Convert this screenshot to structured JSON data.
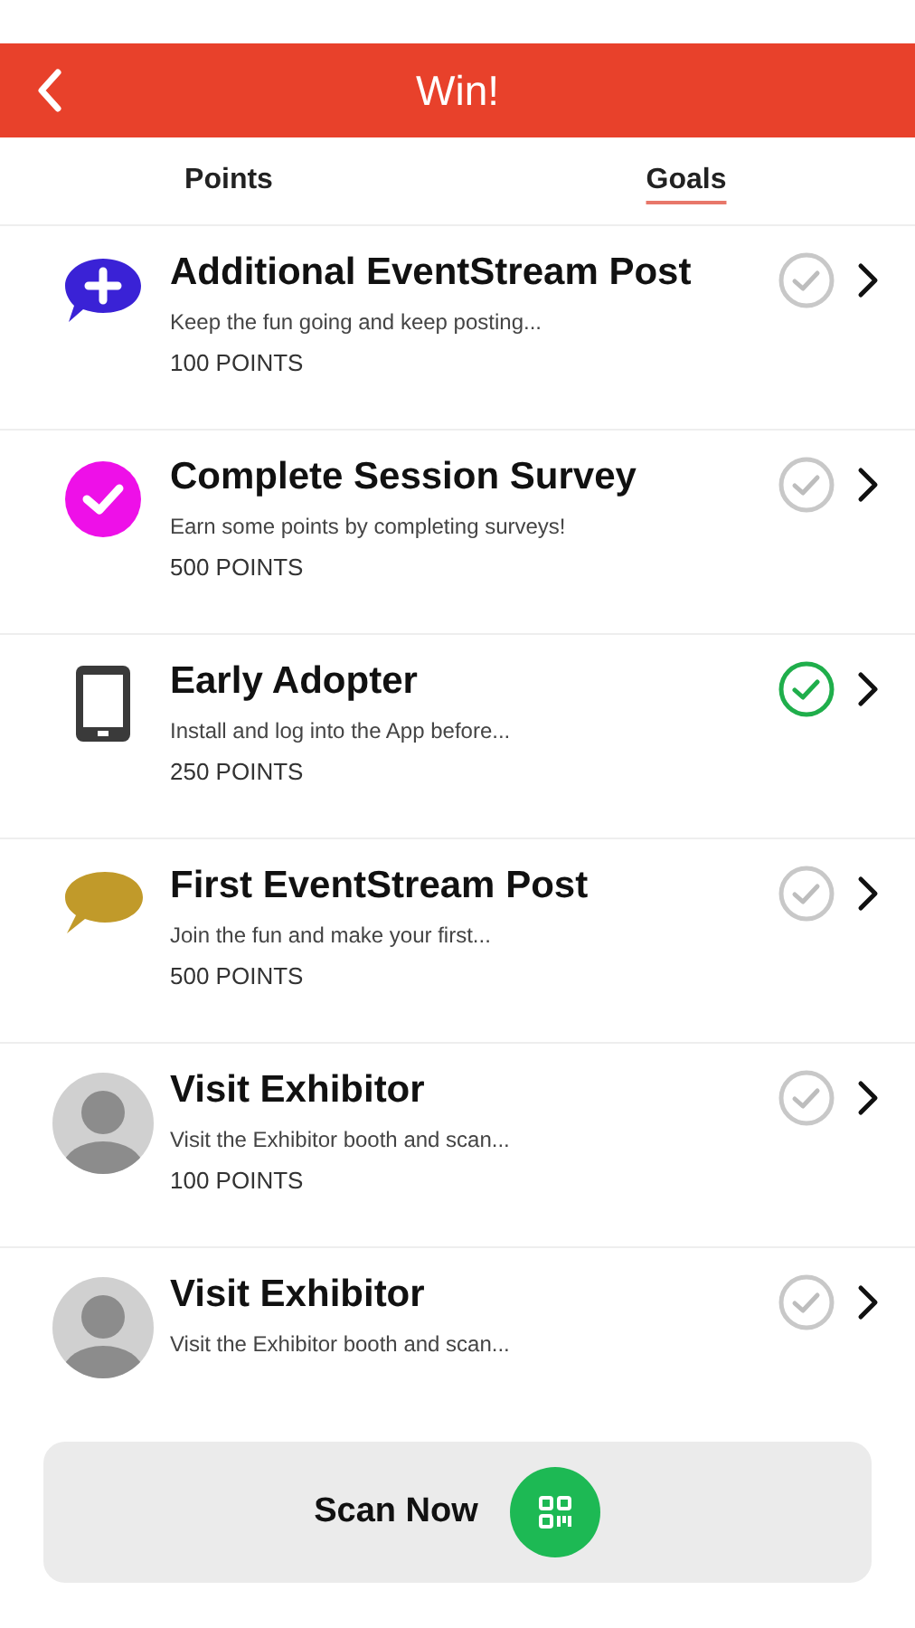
{
  "header": {
    "title": "Win!"
  },
  "tabs": [
    {
      "label": "Points",
      "selected": false
    },
    {
      "label": "Goals",
      "selected": true
    }
  ],
  "goals": [
    {
      "kind": "chat-plus",
      "title": "Additional EventStream Post",
      "description": "Keep the fun going and keep posting...",
      "points": "100 POINTS",
      "completed": false
    },
    {
      "kind": "check-badge",
      "title": "Complete Session Survey",
      "description": "Earn some points by completing surveys!",
      "points": "500 POINTS",
      "completed": false
    },
    {
      "kind": "phone",
      "title": "Early Adopter",
      "description": "Install and log into the App before...",
      "points": "250 POINTS",
      "completed": true
    },
    {
      "kind": "chat",
      "title": "First EventStream Post",
      "description": "Join the fun and make your first...",
      "points": "500 POINTS",
      "completed": false
    },
    {
      "kind": "avatar",
      "title": "Visit Exhibitor",
      "description": "Visit the Exhibitor booth and scan...",
      "points": "100 POINTS",
      "completed": false
    },
    {
      "kind": "avatar",
      "title": "Visit Exhibitor",
      "description": "Visit the Exhibitor booth and scan...",
      "completed": false
    }
  ],
  "scan_button": {
    "label": "Scan Now"
  }
}
